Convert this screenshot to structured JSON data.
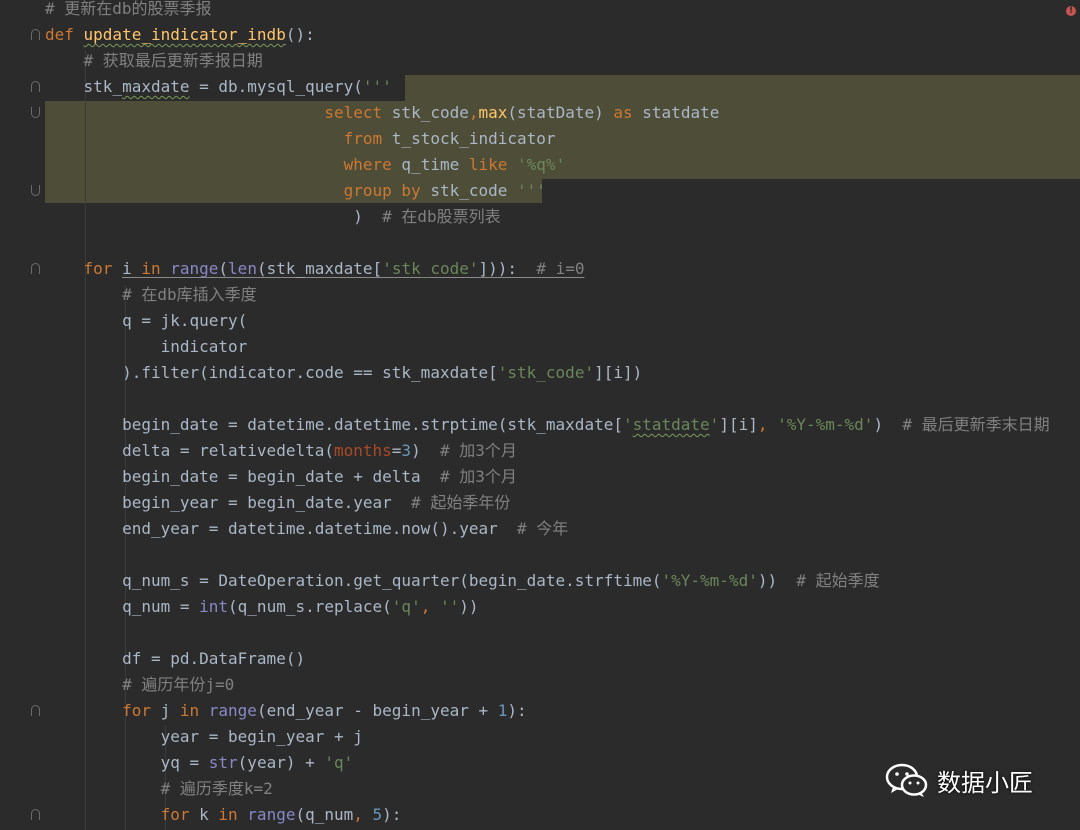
{
  "editor": {
    "language": "python",
    "error_icon": "error-indicator-icon",
    "colors": {
      "background": "#2b2b2b",
      "highlight": "#4e4d38",
      "keyword": "#cc7832",
      "function": "#ffc66d",
      "string": "#6a8759",
      "comment": "#808080",
      "number": "#6897bb",
      "builtin": "#8888c6",
      "parameter": "#aa4926",
      "default": "#a9b7c6"
    },
    "lines": [
      {
        "tokens": [
          {
            "t": "# 更新在db的股票季报",
            "c": "cmt"
          }
        ]
      },
      {
        "tokens": [
          {
            "t": "def ",
            "c": "kw"
          },
          {
            "t": "update_indicator_indb",
            "c": "fn",
            "u": "squig"
          },
          {
            "t": "():",
            "c": ""
          }
        ]
      },
      {
        "tokens": [
          {
            "t": "    "
          },
          {
            "t": "# 获取最后更新季报日期",
            "c": "cmt"
          }
        ]
      },
      {
        "tokens": [
          {
            "t": "    stk_"
          },
          {
            "t": "maxdate",
            "u": "squig"
          },
          {
            "t": " = db.mysql_query("
          },
          {
            "t": "'''",
            "c": "str"
          }
        ]
      },
      {
        "tokens": [
          {
            "t": "                             "
          },
          {
            "t": "select ",
            "c": "sqlkw"
          },
          {
            "t": "stk_code"
          },
          {
            "t": ",",
            "c": "kw"
          },
          {
            "t": "max",
            "c": "sqlfn"
          },
          {
            "t": "(statDate) "
          },
          {
            "t": "as ",
            "c": "sqlkw"
          },
          {
            "t": "statdate"
          }
        ]
      },
      {
        "tokens": [
          {
            "t": "                               "
          },
          {
            "t": "from ",
            "c": "sqlkw"
          },
          {
            "t": "t_stock_indicator"
          }
        ]
      },
      {
        "tokens": [
          {
            "t": "                               "
          },
          {
            "t": "where ",
            "c": "sqlkw"
          },
          {
            "t": "q_time "
          },
          {
            "t": "like ",
            "c": "sqlkw"
          },
          {
            "t": "'%q%'",
            "c": "str"
          }
        ]
      },
      {
        "tokens": [
          {
            "t": "                               "
          },
          {
            "t": "group by ",
            "c": "sqlkw"
          },
          {
            "t": "stk_code "
          },
          {
            "t": "'''",
            "c": "str"
          }
        ]
      },
      {
        "tokens": [
          {
            "t": "                                ) "
          },
          {
            "t": " # 在db股票列表",
            "c": "cmt"
          }
        ]
      },
      {
        "tokens": [
          {
            "t": ""
          }
        ]
      },
      {
        "tokens": [
          {
            "t": "    "
          },
          {
            "t": "for ",
            "c": "kw"
          },
          {
            "t": "i ",
            "u": "uline"
          },
          {
            "t": "in ",
            "c": "kw",
            "u": "uline"
          },
          {
            "t": "range",
            "c": "bi",
            "u": "uline"
          },
          {
            "t": "(",
            "u": "uline"
          },
          {
            "t": "len",
            "c": "bi",
            "u": "uline"
          },
          {
            "t": "(stk_maxdate[",
            "u": "uline"
          },
          {
            "t": "'stk_code'",
            "c": "str",
            "u": "uline"
          },
          {
            "t": "])):  ",
            "u": "uline"
          },
          {
            "t": "# i=0",
            "c": "cmt",
            "u": "uline"
          }
        ]
      },
      {
        "tokens": [
          {
            "t": "        "
          },
          {
            "t": "# 在db库插入季度",
            "c": "cmt"
          }
        ]
      },
      {
        "tokens": [
          {
            "t": "        q = jk.query("
          }
        ]
      },
      {
        "tokens": [
          {
            "t": "            indicator"
          }
        ]
      },
      {
        "tokens": [
          {
            "t": "        ).filter(indicator.code == stk_maxdate["
          },
          {
            "t": "'stk_code'",
            "c": "str"
          },
          {
            "t": "][i])"
          }
        ]
      },
      {
        "tokens": [
          {
            "t": ""
          }
        ]
      },
      {
        "tokens": [
          {
            "t": "        begin_date = datetime.datetime.strptime(stk_maxdate["
          },
          {
            "t": "'",
            "c": "str"
          },
          {
            "t": "statdate",
            "c": "str",
            "u": "squig"
          },
          {
            "t": "'",
            "c": "str"
          },
          {
            "t": "][i]"
          },
          {
            "t": ", ",
            "c": "kw"
          },
          {
            "t": "'%Y-%m-%d'",
            "c": "str"
          },
          {
            "t": ")  "
          },
          {
            "t": "# 最后更新季末日期",
            "c": "cmt"
          }
        ]
      },
      {
        "tokens": [
          {
            "t": "        delta = relativedelta("
          },
          {
            "t": "months",
            "c": "param"
          },
          {
            "t": "="
          },
          {
            "t": "3",
            "c": "num"
          },
          {
            "t": ")  "
          },
          {
            "t": "# 加3个月",
            "c": "cmt"
          }
        ]
      },
      {
        "tokens": [
          {
            "t": "        begin_date = begin_date + delta  "
          },
          {
            "t": "# 加3个月",
            "c": "cmt"
          }
        ]
      },
      {
        "tokens": [
          {
            "t": "        begin_year = begin_date.year  "
          },
          {
            "t": "# 起始季年份",
            "c": "cmt"
          }
        ]
      },
      {
        "tokens": [
          {
            "t": "        end_year = datetime.datetime.now().year  "
          },
          {
            "t": "# 今年",
            "c": "cmt"
          }
        ]
      },
      {
        "tokens": [
          {
            "t": ""
          }
        ]
      },
      {
        "tokens": [
          {
            "t": "        q_num_s = DateOperation.get_quarter(begin_date.strftime("
          },
          {
            "t": "'%Y-%m-%d'",
            "c": "str"
          },
          {
            "t": "))  "
          },
          {
            "t": "# 起始季度",
            "c": "cmt"
          }
        ]
      },
      {
        "tokens": [
          {
            "t": "        q_num = "
          },
          {
            "t": "int",
            "c": "bi"
          },
          {
            "t": "(q_num_s.replace("
          },
          {
            "t": "'q'",
            "c": "str"
          },
          {
            "t": ", ",
            "c": "kw"
          },
          {
            "t": "''",
            "c": "str"
          },
          {
            "t": "))"
          }
        ]
      },
      {
        "tokens": [
          {
            "t": ""
          }
        ]
      },
      {
        "tokens": [
          {
            "t": "        df = pd.DataFrame()"
          }
        ]
      },
      {
        "tokens": [
          {
            "t": "        "
          },
          {
            "t": "# 遍历年份j=0",
            "c": "cmt"
          }
        ]
      },
      {
        "tokens": [
          {
            "t": "        "
          },
          {
            "t": "for ",
            "c": "kw"
          },
          {
            "t": "j "
          },
          {
            "t": "in ",
            "c": "kw"
          },
          {
            "t": "range",
            "c": "bi"
          },
          {
            "t": "(end_year - begin_year + "
          },
          {
            "t": "1",
            "c": "num"
          },
          {
            "t": "):"
          }
        ]
      },
      {
        "tokens": [
          {
            "t": "            year = begin_year + j"
          }
        ]
      },
      {
        "tokens": [
          {
            "t": "            yq = "
          },
          {
            "t": "str",
            "c": "bi"
          },
          {
            "t": "(year) + "
          },
          {
            "t": "'q'",
            "c": "str"
          }
        ]
      },
      {
        "tokens": [
          {
            "t": "            "
          },
          {
            "t": "# 遍历季度k=2",
            "c": "cmt"
          }
        ]
      },
      {
        "tokens": [
          {
            "t": "            "
          },
          {
            "t": "for ",
            "c": "kw"
          },
          {
            "t": "k "
          },
          {
            "t": "in ",
            "c": "kw"
          },
          {
            "t": "range",
            "c": "bi"
          },
          {
            "t": "(q_num"
          },
          {
            "t": ", ",
            "c": "kw"
          },
          {
            "t": "5",
            "c": "num"
          },
          {
            "t": "):"
          }
        ]
      }
    ]
  },
  "watermark": {
    "icon": "wechat-icon",
    "text": "数据小匠"
  }
}
